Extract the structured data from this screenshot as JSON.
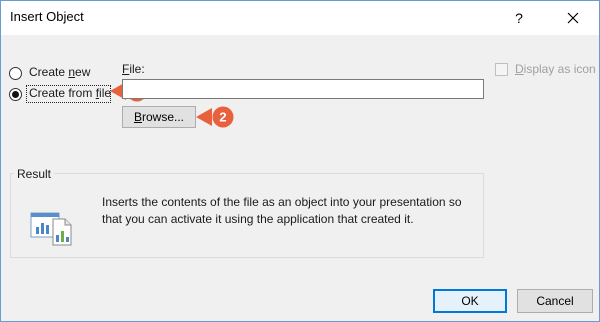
{
  "window": {
    "title": "Insert Object",
    "help_label": "?",
    "close_icon": "close-icon"
  },
  "options": {
    "create_new": {
      "pre": "Create ",
      "key": "n",
      "post": "ew",
      "selected": false
    },
    "create_from_file": {
      "pre": "Create from ",
      "key": "f",
      "post": "ile",
      "selected": true
    }
  },
  "file": {
    "label_key": "F",
    "label_rest": "ile:",
    "value": "",
    "browse_key": "B",
    "browse_rest": "rowse..."
  },
  "display_as_icon": {
    "key": "D",
    "rest": "isplay as icon",
    "checked": false,
    "enabled": false
  },
  "callouts": [
    {
      "number": "1",
      "color": "#e8603c"
    },
    {
      "number": "2",
      "color": "#e8603c"
    }
  ],
  "result": {
    "title": "Result",
    "text": "Inserts the contents of the file as an object into your presentation so that you can activate it using the application that created it.",
    "icon": "document-chart-icon"
  },
  "buttons": {
    "ok": "OK",
    "cancel": "Cancel"
  }
}
